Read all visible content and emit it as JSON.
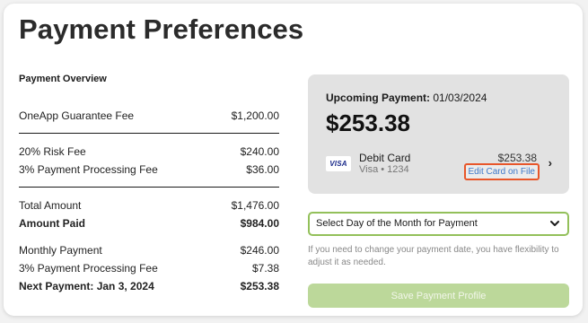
{
  "page": {
    "title": "Payment Preferences"
  },
  "overview": {
    "heading": "Payment Overview",
    "groups": [
      [
        {
          "label": "OneApp Guarantee Fee",
          "value": "$1,200.00",
          "bold": false
        }
      ],
      [
        {
          "label": "20% Risk Fee",
          "value": "$240.00",
          "bold": false
        },
        {
          "label": "3% Payment Processing Fee",
          "value": "$36.00",
          "bold": false
        }
      ],
      [
        {
          "label": "Total Amount",
          "value": "$1,476.00",
          "bold": false
        },
        {
          "label": "Amount Paid",
          "value": "$984.00",
          "bold": true
        }
      ],
      [
        {
          "label": "Monthly Payment",
          "value": "$246.00",
          "bold": false
        },
        {
          "label": "3% Payment Processing Fee",
          "value": "$7.38",
          "bold": false
        },
        {
          "label": "Next Payment: Jan 3, 2024",
          "value": "$253.38",
          "bold": true
        }
      ]
    ]
  },
  "upcoming": {
    "label": "Upcoming Payment:",
    "date": "01/03/2024",
    "amount": "$253.38",
    "method": {
      "brand": "VISA",
      "name": "Debit Card",
      "detail": "Visa • 1234",
      "amount": "$253.38",
      "edit_label": "Edit Card on File",
      "icon": "chevron-right-icon"
    }
  },
  "day_select": {
    "value": "Select Day of the Month for Payment",
    "icon": "chevron-down-icon"
  },
  "hint": "If you need to change your payment date, you have flexibility to adjust it as needed.",
  "save_label": "Save Payment Profile",
  "colors": {
    "accent_green": "#93c05a",
    "button_disabled": "#bcd89a",
    "highlight": "#e8562a",
    "link": "#3f79c9"
  }
}
